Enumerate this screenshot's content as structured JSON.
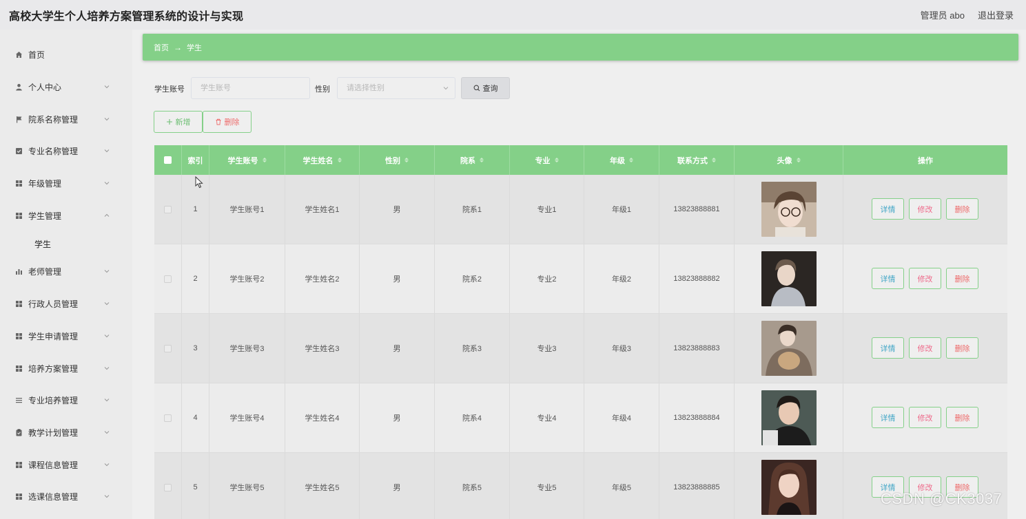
{
  "header": {
    "app_title": "高校大学生个人培养方案管理系统的设计与实现",
    "user_label": "管理员 abo",
    "logout_label": "退出登录"
  },
  "sidebar": {
    "items": [
      {
        "label": "首页",
        "icon": "home-icon",
        "has_children": false
      },
      {
        "label": "个人中心",
        "icon": "user-icon",
        "has_children": true
      },
      {
        "label": "院系名称管理",
        "icon": "flag-icon",
        "has_children": true
      },
      {
        "label": "专业名称管理",
        "icon": "checkbox-icon",
        "has_children": true
      },
      {
        "label": "年级管理",
        "icon": "grid-icon",
        "has_children": true
      },
      {
        "label": "学生管理",
        "icon": "grid-icon",
        "has_children": true,
        "expanded": true,
        "children": [
          "学生"
        ]
      },
      {
        "label": "老师管理",
        "icon": "bar-chart-icon",
        "has_children": true
      },
      {
        "label": "行政人员管理",
        "icon": "grid-icon",
        "has_children": true
      },
      {
        "label": "学生申请管理",
        "icon": "grid-icon",
        "has_children": true
      },
      {
        "label": "培养方案管理",
        "icon": "grid-icon",
        "has_children": true
      },
      {
        "label": "专业培养管理",
        "icon": "list-icon",
        "has_children": true
      },
      {
        "label": "教学计划管理",
        "icon": "clipboard-icon",
        "has_children": true
      },
      {
        "label": "课程信息管理",
        "icon": "grid-icon",
        "has_children": true
      },
      {
        "label": "选课信息管理",
        "icon": "grid-icon",
        "has_children": true
      }
    ]
  },
  "breadcrumb": {
    "home": "首页",
    "separator": "→",
    "current": "学生"
  },
  "search": {
    "account_label": "学生账号",
    "account_placeholder": "学生账号",
    "gender_label": "性别",
    "gender_placeholder": "请选择性别",
    "query_label": "查询"
  },
  "actions": {
    "add_label": "新增",
    "delete_label": "删除"
  },
  "table": {
    "columns": [
      "索引",
      "学生账号",
      "学生姓名",
      "性别",
      "院系",
      "专业",
      "年级",
      "联系方式",
      "头像",
      "操作"
    ],
    "rows": [
      {
        "index": "1",
        "account": "学生账号1",
        "name": "学生姓名1",
        "gender": "男",
        "dept": "院系1",
        "major": "专业1",
        "grade": "年级1",
        "phone": "13823888881"
      },
      {
        "index": "2",
        "account": "学生账号2",
        "name": "学生姓名2",
        "gender": "男",
        "dept": "院系2",
        "major": "专业2",
        "grade": "年级2",
        "phone": "13823888882"
      },
      {
        "index": "3",
        "account": "学生账号3",
        "name": "学生姓名3",
        "gender": "男",
        "dept": "院系3",
        "major": "专业3",
        "grade": "年级3",
        "phone": "13823888883"
      },
      {
        "index": "4",
        "account": "学生账号4",
        "name": "学生姓名4",
        "gender": "男",
        "dept": "院系4",
        "major": "专业4",
        "grade": "年级4",
        "phone": "13823888884"
      },
      {
        "index": "5",
        "account": "学生账号5",
        "name": "学生姓名5",
        "gender": "男",
        "dept": "院系5",
        "major": "专业5",
        "grade": "年级5",
        "phone": "13823888885"
      }
    ],
    "row_actions": {
      "detail": "详情",
      "edit": "修改",
      "remove": "删除"
    }
  },
  "watermark": "CSDN @CK3037",
  "colors": {
    "accent_green": "#84d088",
    "detail_text": "#42a6c6",
    "edit_text": "#ee6b8b",
    "delete_text": "#ee6b6b"
  }
}
